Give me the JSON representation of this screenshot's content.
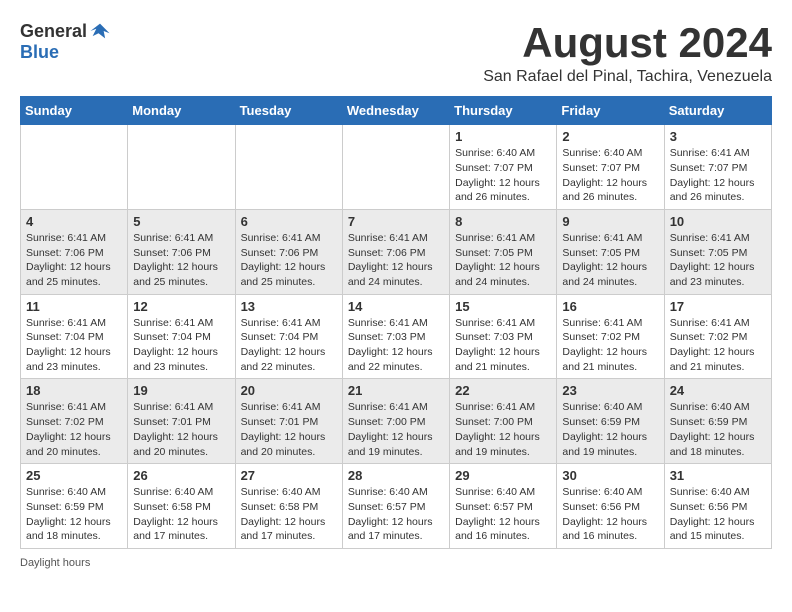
{
  "header": {
    "logo_general": "General",
    "logo_blue": "Blue",
    "month_title": "August 2024",
    "location": "San Rafael del Pinal, Tachira, Venezuela"
  },
  "weekdays": [
    "Sunday",
    "Monday",
    "Tuesday",
    "Wednesday",
    "Thursday",
    "Friday",
    "Saturday"
  ],
  "weeks": [
    [
      {
        "day": "",
        "info": ""
      },
      {
        "day": "",
        "info": ""
      },
      {
        "day": "",
        "info": ""
      },
      {
        "day": "",
        "info": ""
      },
      {
        "day": "1",
        "info": "Sunrise: 6:40 AM\nSunset: 7:07 PM\nDaylight: 12 hours\nand 26 minutes."
      },
      {
        "day": "2",
        "info": "Sunrise: 6:40 AM\nSunset: 7:07 PM\nDaylight: 12 hours\nand 26 minutes."
      },
      {
        "day": "3",
        "info": "Sunrise: 6:41 AM\nSunset: 7:07 PM\nDaylight: 12 hours\nand 26 minutes."
      }
    ],
    [
      {
        "day": "4",
        "info": "Sunrise: 6:41 AM\nSunset: 7:06 PM\nDaylight: 12 hours\nand 25 minutes."
      },
      {
        "day": "5",
        "info": "Sunrise: 6:41 AM\nSunset: 7:06 PM\nDaylight: 12 hours\nand 25 minutes."
      },
      {
        "day": "6",
        "info": "Sunrise: 6:41 AM\nSunset: 7:06 PM\nDaylight: 12 hours\nand 25 minutes."
      },
      {
        "day": "7",
        "info": "Sunrise: 6:41 AM\nSunset: 7:06 PM\nDaylight: 12 hours\nand 24 minutes."
      },
      {
        "day": "8",
        "info": "Sunrise: 6:41 AM\nSunset: 7:05 PM\nDaylight: 12 hours\nand 24 minutes."
      },
      {
        "day": "9",
        "info": "Sunrise: 6:41 AM\nSunset: 7:05 PM\nDaylight: 12 hours\nand 24 minutes."
      },
      {
        "day": "10",
        "info": "Sunrise: 6:41 AM\nSunset: 7:05 PM\nDaylight: 12 hours\nand 23 minutes."
      }
    ],
    [
      {
        "day": "11",
        "info": "Sunrise: 6:41 AM\nSunset: 7:04 PM\nDaylight: 12 hours\nand 23 minutes."
      },
      {
        "day": "12",
        "info": "Sunrise: 6:41 AM\nSunset: 7:04 PM\nDaylight: 12 hours\nand 23 minutes."
      },
      {
        "day": "13",
        "info": "Sunrise: 6:41 AM\nSunset: 7:04 PM\nDaylight: 12 hours\nand 22 minutes."
      },
      {
        "day": "14",
        "info": "Sunrise: 6:41 AM\nSunset: 7:03 PM\nDaylight: 12 hours\nand 22 minutes."
      },
      {
        "day": "15",
        "info": "Sunrise: 6:41 AM\nSunset: 7:03 PM\nDaylight: 12 hours\nand 21 minutes."
      },
      {
        "day": "16",
        "info": "Sunrise: 6:41 AM\nSunset: 7:02 PM\nDaylight: 12 hours\nand 21 minutes."
      },
      {
        "day": "17",
        "info": "Sunrise: 6:41 AM\nSunset: 7:02 PM\nDaylight: 12 hours\nand 21 minutes."
      }
    ],
    [
      {
        "day": "18",
        "info": "Sunrise: 6:41 AM\nSunset: 7:02 PM\nDaylight: 12 hours\nand 20 minutes."
      },
      {
        "day": "19",
        "info": "Sunrise: 6:41 AM\nSunset: 7:01 PM\nDaylight: 12 hours\nand 20 minutes."
      },
      {
        "day": "20",
        "info": "Sunrise: 6:41 AM\nSunset: 7:01 PM\nDaylight: 12 hours\nand 20 minutes."
      },
      {
        "day": "21",
        "info": "Sunrise: 6:41 AM\nSunset: 7:00 PM\nDaylight: 12 hours\nand 19 minutes."
      },
      {
        "day": "22",
        "info": "Sunrise: 6:41 AM\nSunset: 7:00 PM\nDaylight: 12 hours\nand 19 minutes."
      },
      {
        "day": "23",
        "info": "Sunrise: 6:40 AM\nSunset: 6:59 PM\nDaylight: 12 hours\nand 19 minutes."
      },
      {
        "day": "24",
        "info": "Sunrise: 6:40 AM\nSunset: 6:59 PM\nDaylight: 12 hours\nand 18 minutes."
      }
    ],
    [
      {
        "day": "25",
        "info": "Sunrise: 6:40 AM\nSunset: 6:59 PM\nDaylight: 12 hours\nand 18 minutes."
      },
      {
        "day": "26",
        "info": "Sunrise: 6:40 AM\nSunset: 6:58 PM\nDaylight: 12 hours\nand 17 minutes."
      },
      {
        "day": "27",
        "info": "Sunrise: 6:40 AM\nSunset: 6:58 PM\nDaylight: 12 hours\nand 17 minutes."
      },
      {
        "day": "28",
        "info": "Sunrise: 6:40 AM\nSunset: 6:57 PM\nDaylight: 12 hours\nand 17 minutes."
      },
      {
        "day": "29",
        "info": "Sunrise: 6:40 AM\nSunset: 6:57 PM\nDaylight: 12 hours\nand 16 minutes."
      },
      {
        "day": "30",
        "info": "Sunrise: 6:40 AM\nSunset: 6:56 PM\nDaylight: 12 hours\nand 16 minutes."
      },
      {
        "day": "31",
        "info": "Sunrise: 6:40 AM\nSunset: 6:56 PM\nDaylight: 12 hours\nand 15 minutes."
      }
    ]
  ],
  "footer": {
    "daylight_label": "Daylight hours"
  },
  "colors": {
    "header_bg": "#2a6db5",
    "shaded_row": "#ebebeb",
    "white_row": "#ffffff",
    "empty_cell": "#f5f5f5"
  }
}
